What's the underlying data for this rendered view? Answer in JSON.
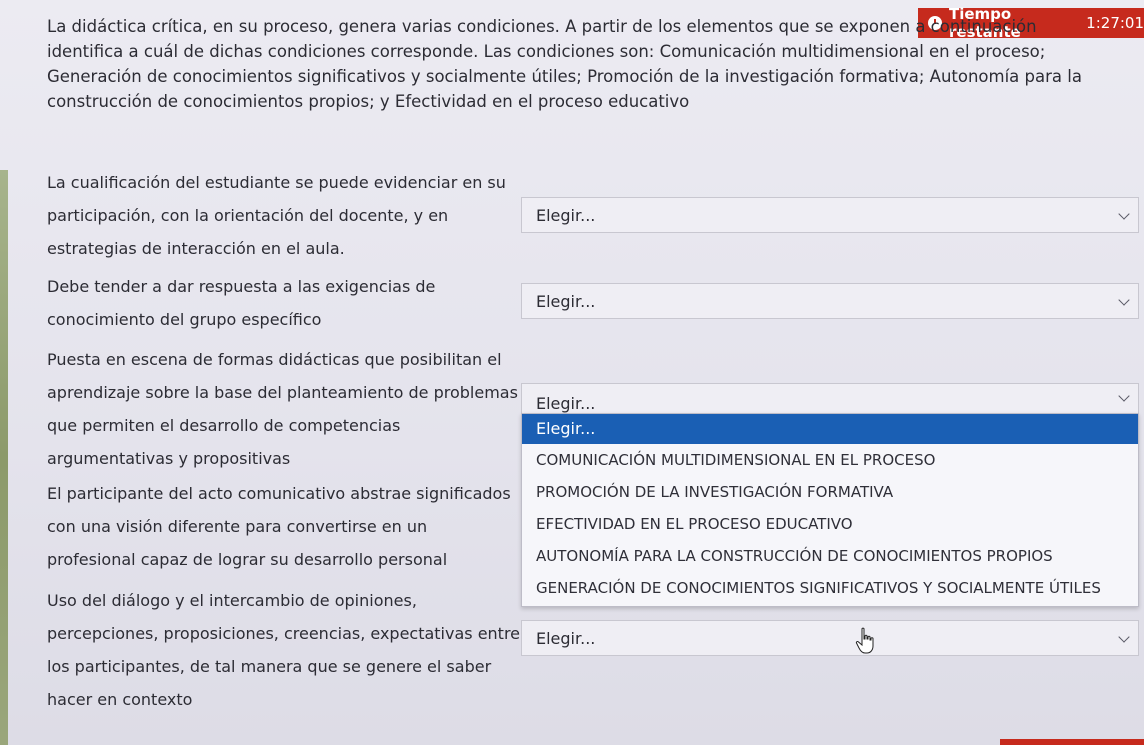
{
  "timer": {
    "label": "Tiempo restante",
    "time": "1:27:01"
  },
  "intro": "La didáctica crítica, en su proceso, genera varias condiciones. A partir de los elementos que se exponen a continuación identifica a cuál de dichas condiciones corresponde. Las condiciones son: Comunicación multidimensional en el proceso; Generación de conocimientos significativos y socialmente útiles; Promoción de la investigación formativa; Autonomía para la construcción de conocimientos propios; y Efectividad en el proceso educativo",
  "items": [
    {
      "lines": [
        "La cualificación del estudiante se puede evidenciar en su",
        "participación, con la orientación del docente, y en",
        "estrategias de interacción en el aula."
      ],
      "select_value": "Elegir..."
    },
    {
      "lines": [
        "Debe tender a dar respuesta a las exigencias de",
        "conocimiento del grupo específico"
      ],
      "select_value": "Elegir..."
    },
    {
      "lines": [
        "Puesta en escena de formas didácticas que posibilitan el",
        "aprendizaje sobre la base del planteamiento de problemas",
        "que permiten el desarrollo de competencias",
        "argumentativas y propositivas"
      ],
      "select_value": "Elegir..."
    },
    {
      "lines": [
        "El participante del acto comunicativo abstrae significados",
        "con una visión diferente para convertirse en un",
        "profesional capaz de lograr su desarrollo personal"
      ],
      "select_value": ""
    },
    {
      "lines": [
        "Uso del diálogo y el intercambio de opiniones,",
        "percepciones, proposiciones, creencias, expectativas entre",
        "los participantes, de tal manera que se genere el saber",
        "hacer en contexto"
      ],
      "select_value": "Elegir..."
    }
  ],
  "dropdown": {
    "options": [
      "Elegir...",
      "COMUNICACIÓN MULTIDIMENSIONAL EN EL PROCESO",
      "PROMOCIÓN DE LA INVESTIGACIÓN FORMATIVA",
      "EFECTIVIDAD EN EL PROCESO EDUCATIVO",
      "AUTONOMÍA PARA LA CONSTRUCCIÓN DE CONOCIMIENTOS PROPIOS",
      "GENERACIÓN DE CONOCIMIENTOS SIGNIFICATIVOS Y SOCIALMENTE ÚTILES"
    ],
    "selected_index": 0
  },
  "colors": {
    "timer_bg": "#c62a1d",
    "selected_option_bg": "#1a5fb4"
  }
}
